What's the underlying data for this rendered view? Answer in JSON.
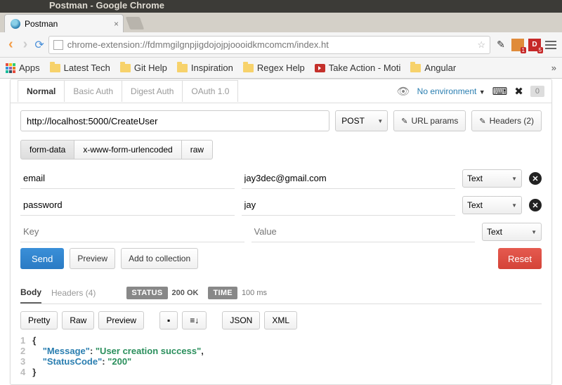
{
  "window": {
    "title": "Postman - Google Chrome"
  },
  "tab": {
    "label": "Postman"
  },
  "url": "chrome-extension://fdmmgilgnpjigdojojpjoooidkmcomcm/index.ht",
  "ext_badges": {
    "orange": "1",
    "red_letter": "D",
    "red": "5"
  },
  "bookmarks": [
    "Apps",
    "Latest Tech",
    "Git Help",
    "Inspiration",
    "Regex Help",
    "Take Action - Moti",
    "Angular"
  ],
  "pm": {
    "tabs": [
      "Normal",
      "Basic Auth",
      "Digest Auth",
      "OAuth 1.0"
    ],
    "active_tab": 0,
    "env_label": "No environment",
    "history_count": "0",
    "request_url": "http://localhost:5000/CreateUser",
    "method": "POST",
    "url_params_btn": "URL params",
    "headers_btn": "Headers (2)",
    "body_types": [
      "form-data",
      "x-www-form-urlencoded",
      "raw"
    ],
    "body_active": 0,
    "form": [
      {
        "key": "email",
        "value": "jay3dec@gmail.com",
        "type": "Text"
      },
      {
        "key": "password",
        "value": "jay",
        "type": "Text"
      }
    ],
    "placeholder_key": "Key",
    "placeholder_value": "Value",
    "placeholder_type": "Text",
    "send": "Send",
    "preview": "Preview",
    "add": "Add to collection",
    "reset": "Reset"
  },
  "resp": {
    "tabs": [
      "Body",
      "Headers (4)"
    ],
    "status_label": "STATUS",
    "status_val": "200 OK",
    "time_label": "TIME",
    "time_val": "100 ms",
    "ctrls": [
      "Pretty",
      "Raw",
      "Preview"
    ],
    "fmt1": "JSON",
    "fmt2": "XML",
    "json": {
      "k1": "\"Message\"",
      "v1": "\"User creation success\"",
      "k2": "\"StatusCode\"",
      "v2": "\"200\""
    }
  }
}
